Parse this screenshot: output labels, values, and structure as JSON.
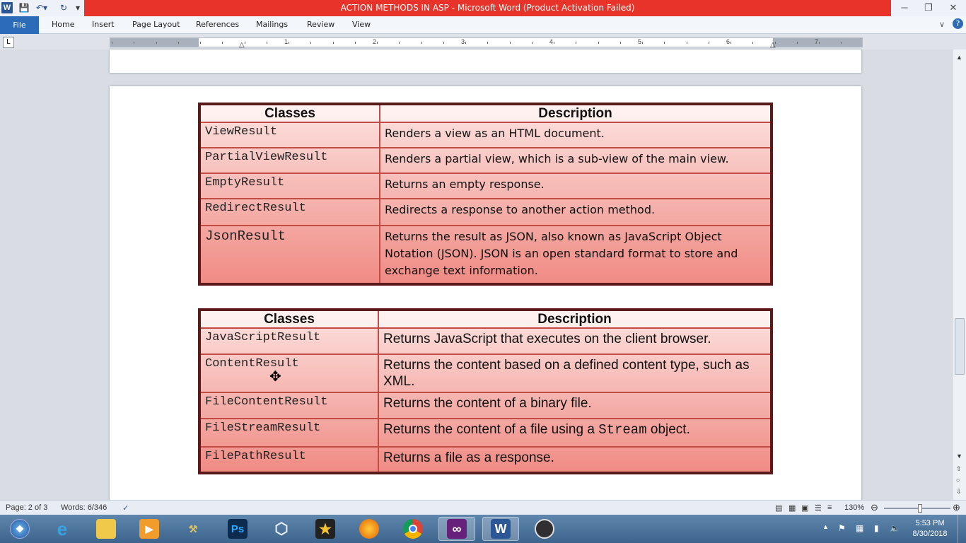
{
  "window": {
    "title": "ACTION METHODS IN ASP  -  Microsoft Word (Product Activation Failed)",
    "app_letter": "W",
    "title_color": "#e8332a"
  },
  "ribbon": {
    "file": "File",
    "tabs": [
      "Home",
      "Insert",
      "Page Layout",
      "References",
      "Mailings",
      "Review",
      "View"
    ]
  },
  "ruler": {
    "numbers": [
      "1",
      "2",
      "3",
      "4",
      "5",
      "6",
      "7"
    ]
  },
  "table1": {
    "headers": [
      "Classes",
      "Description"
    ],
    "rows": [
      {
        "cls": "ViewResult",
        "desc": "Renders a view as an HTML document."
      },
      {
        "cls": "PartialViewResult",
        "desc": "Renders a partial view, which is a sub-view of the main view."
      },
      {
        "cls": "EmptyResult",
        "desc": "Returns an empty response."
      },
      {
        "cls": "RedirectResult",
        "desc": "Redirects a response to another action method."
      },
      {
        "cls": "JsonResult",
        "desc": "Returns the result as JSON, also known as JavaScript Object Notation (JSON). JSON is an open standard format to store and exchange text information."
      }
    ]
  },
  "table2": {
    "headers": [
      "Classes",
      "Description"
    ],
    "rows": [
      {
        "cls": "JavaScriptResult",
        "desc": "Returns JavaScript that executes on the client browser."
      },
      {
        "cls": "ContentResult",
        "desc": "Returns the content based on a defined content type, such as XML."
      },
      {
        "cls": "FileContentResult",
        "desc": "Returns the content of a binary file."
      },
      {
        "cls": "FileStreamResult",
        "desc_pre": "Returns the content of a file using a ",
        "desc_code": "Stream",
        "desc_post": " object."
      },
      {
        "cls": "FilePathResult",
        "desc": "Returns a file as a response."
      }
    ]
  },
  "status": {
    "page": "Page: 2 of 3",
    "words": "Words: 6/346",
    "zoom": "130%",
    "zoom_level": 1.3
  },
  "clock": {
    "time": "5:53 PM",
    "date": "8/30/2018"
  },
  "taskbar": {
    "apps": [
      "start",
      "internet-explorer",
      "file-explorer",
      "media-player",
      "tools",
      "photoshop",
      "box-app",
      "movie-maker",
      "firefox",
      "chrome",
      "visual-studio",
      "word",
      "obs"
    ],
    "ps_label": "Ps",
    "word_label": "W"
  }
}
